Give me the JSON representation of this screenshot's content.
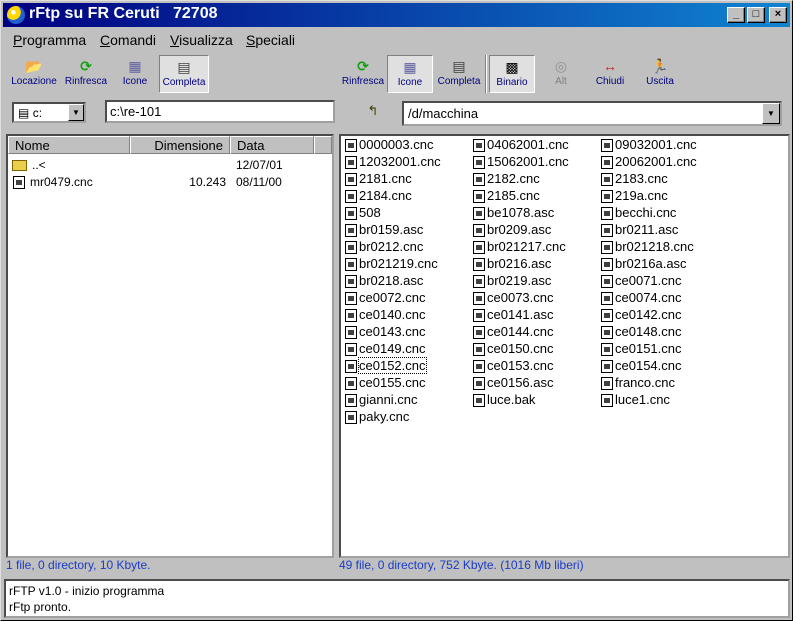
{
  "window": {
    "title": "rFtp su FR Ceruti   72708",
    "controls": {
      "minimize": "_",
      "maximize": "□",
      "close": "×"
    }
  },
  "menu": [
    {
      "label": "Programma",
      "hotkey": "P",
      "rest": "rogramma"
    },
    {
      "label": "Comandi",
      "hotkey": "C",
      "rest": "omandi"
    },
    {
      "label": "Visualizza",
      "hotkey": "V",
      "rest": "isualizza"
    },
    {
      "label": "Speciali",
      "hotkey": "S",
      "rest": "peciali"
    }
  ],
  "toolbar_left": {
    "locazione": "Locazione",
    "rinfresca": "Rinfresca",
    "icone": "Icone",
    "completa": "Completa"
  },
  "toolbar_right": {
    "rinfresca": "Rinfresca",
    "icone": "Icone",
    "completa": "Completa",
    "binario": "Binario",
    "alt": "Alt",
    "chiudi": "Chiudi",
    "uscita": "Uscita"
  },
  "local": {
    "drive": "c:",
    "path": "c:\\re-101",
    "columns": {
      "name": "Nome",
      "size": "Dimensione",
      "date": "Data"
    },
    "rows": [
      {
        "name": "..<",
        "size": "",
        "date": "12/07/01",
        "type": "folder"
      },
      {
        "name": "mr0479.cnc",
        "size": "10.243",
        "date": "08/11/00",
        "type": "file"
      }
    ],
    "status": "1 file, 0 directory, 10 Kbyte."
  },
  "remote": {
    "path": "/d/macchina",
    "columns": [
      [
        "0000003.cnc",
        "12032001.cnc",
        "2181.cnc",
        "2184.cnc",
        "508",
        "br0159.asc",
        "br0212.cnc",
        "br021219.cnc",
        "br0218.asc",
        "ce0072.cnc",
        "ce0140.cnc",
        "ce0143.cnc",
        "ce0149.cnc",
        "ce0152.cnc",
        "ce0155.cnc",
        "gianni.cnc",
        "paky.cnc"
      ],
      [
        "04062001.cnc",
        "15062001.cnc",
        "2182.cnc",
        "2185.cnc",
        "be1078.asc",
        "br0209.asc",
        "br021217.cnc",
        "br0216.asc",
        "br0219.asc",
        "ce0073.cnc",
        "ce0141.asc",
        "ce0144.cnc",
        "ce0150.cnc",
        "ce0153.cnc",
        "ce0156.asc",
        "luce.bak"
      ],
      [
        "09032001.cnc",
        "20062001.cnc",
        "2183.cnc",
        "219a.cnc",
        "becchi.cnc",
        "br0211.asc",
        "br021218.cnc",
        "br0216a.asc",
        "ce0071.cnc",
        "ce0074.cnc",
        "ce0142.cnc",
        "ce0148.cnc",
        "ce0151.cnc",
        "ce0154.cnc",
        "franco.cnc",
        "luce1.cnc"
      ]
    ],
    "selected": "ce0152.cnc",
    "status": "49 file, 0 directory, 752 Kbyte. (1016 Mb liberi)"
  },
  "log": [
    "rFTP v1.0 - inizio programma",
    "rFtp pronto."
  ],
  "colors": {
    "titlebar_start": "#000080",
    "titlebar_end": "#1084d0",
    "status_text": "#1a3cc8",
    "toolbar_label": "#000080"
  }
}
